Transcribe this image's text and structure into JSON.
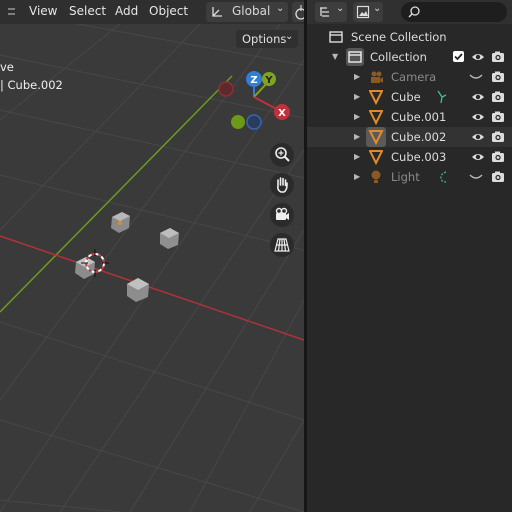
{
  "viewport": {
    "menus": [
      "View",
      "Select",
      "Add",
      "Object"
    ],
    "orientation": "Global",
    "options_label": "Options",
    "info_line1": "ve",
    "info_line2": "| Cube.002",
    "gizmo": {
      "z": "Z",
      "y": "Y",
      "x": "X"
    }
  },
  "outliner": {
    "rows": [
      {
        "label": "Scene Collection",
        "icon": "scene-collection-icon"
      },
      {
        "label": "Collection",
        "icon": "collection-icon"
      },
      {
        "label": "Camera",
        "icon": "camera-object-icon"
      },
      {
        "label": "Cube",
        "icon": "mesh-object-icon"
      },
      {
        "label": "Cube.001",
        "icon": "mesh-object-icon"
      },
      {
        "label": "Cube.002",
        "icon": "mesh-object-icon"
      },
      {
        "label": "Cube.003",
        "icon": "mesh-object-icon"
      },
      {
        "label": "Light",
        "icon": "light-object-icon"
      }
    ]
  },
  "colors": {
    "x_axis": "#c0313b",
    "y_axis": "#7ea51d",
    "z_axis": "#2f7fd8",
    "object_orange": "#e08a2a"
  }
}
